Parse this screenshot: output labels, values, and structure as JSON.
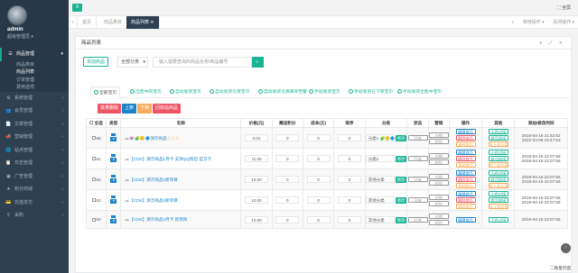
{
  "sidebar": {
    "username": "admin",
    "role": "超级管理员 ▾",
    "menu": [
      {
        "label": "商品管理",
        "active": true
      },
      {
        "label": "商品类目"
      },
      {
        "label": "商品列表",
        "current": true
      },
      {
        "label": "订单管理"
      },
      {
        "label": "费用选项"
      },
      {
        "label": "系统管理"
      },
      {
        "label": "会员管理"
      },
      {
        "label": "文章管理"
      },
      {
        "label": "营销管理"
      },
      {
        "label": "站点管理"
      },
      {
        "label": "日志管理"
      },
      {
        "label": "广告管理"
      },
      {
        "label": "积分商城"
      },
      {
        "label": "充值支付"
      },
      {
        "label": "采购"
      }
    ]
  },
  "topbar": {
    "fullscreen": "全屏"
  },
  "tabs": {
    "items": [
      "首页",
      "商品类目",
      "商品列表"
    ],
    "tools": [
      "常用操作 ▾",
      "关闭操作 ▾"
    ]
  },
  "panel": {
    "title": "商品列表",
    "controls": "▾ ⤢ ✕",
    "add_button": "添加商品",
    "category_select": "全部分类",
    "search_placeholder": "输入需要查询的商品名称/商品编号",
    "search_button": "搜索"
  },
  "filter_tabs": [
    "全部宝贝",
    "出售中的宝贝",
    "自动发货宝贝",
    "自动发货仓库宝贝",
    "自动发货仓库库存告警",
    "手动发货宝贝",
    "手动发货已下架宝贝",
    "手动发货出售中宝贝"
  ],
  "actions": [
    {
      "label": "批量删除",
      "color": "#ed5565"
    },
    {
      "label": "上架",
      "color": "#1c84c6"
    },
    {
      "label": "下架",
      "color": "#f8ac59"
    },
    {
      "label": "回收站商品",
      "color": "#ed5565"
    }
  ],
  "table": {
    "headers": [
      "全选",
      "类型",
      "名称",
      "价格(元)",
      "赠送积分",
      "成本(元)",
      "排序",
      "分类",
      "状态",
      "营销",
      "操作",
      "其他",
      "添加/修改时间"
    ],
    "rows": [
      {
        "id": "58",
        "name": "演示商品",
        "prefix": "👾🧩🙂🔷",
        "stars": "☆☆☆",
        "price": "0.01",
        "points": "0",
        "cost": "0",
        "sort": "0",
        "category": "分类1 🧩🙂🔷",
        "status": "开放",
        "tags": [
          "分销",
          "短信"
        ],
        "ops": [
          "编辑商品",
          "删除商品",
          "复制商品"
        ],
        "others": [
          "小鸡对接",
          "商品链接",
          "发上架价值"
        ],
        "time1": "2019-04-16 21:52:52",
        "time2": "2022-04-08 15:47:53"
      },
      {
        "id": "61",
        "name": "【CDK】演示商品1月卡 支持QQ钱包 官方卡",
        "prefix": "",
        "stars": "",
        "price": "11.00",
        "points": "0",
        "cost": "0",
        "sort": "0",
        "category": "分类2",
        "status": "开放",
        "tags": [
          "分销",
          "短信"
        ],
        "ops": [
          "编辑商品",
          "删除商品",
          "复制商品"
        ],
        "others": [
          "小鸡对接",
          "商品链接",
          "发上架价值"
        ],
        "time1": "2019-04-16 22:07:56",
        "time2": "2019-04-16 22:07:56"
      },
      {
        "id": "62",
        "name": "【CDK】演示商品2新项目",
        "prefix": "",
        "stars": "",
        "price": "10.00",
        "points": "0",
        "cost": "0",
        "sort": "0",
        "category": "其他分类",
        "status": "开放",
        "tags": [
          "分销",
          "短信"
        ],
        "ops": [
          "编辑商品",
          "删除商品",
          "复制商品"
        ],
        "others": [
          "小鸡对接",
          "商品链接",
          "发上架价值"
        ],
        "time1": "2019-04-16 22:07:56",
        "time2": "2019-04-16 22:07:56"
      },
      {
        "id": "63",
        "name": "【CDK】演示商品3新项目",
        "prefix": "",
        "stars": "",
        "price": "10.00",
        "points": "0",
        "cost": "0",
        "sort": "0",
        "category": "其他分类",
        "status": "开放",
        "tags": [
          "分销",
          "短信"
        ],
        "ops": [
          "编辑商品",
          "删除商品",
          "复制商品"
        ],
        "others": [
          "小鸡对接",
          "商品链接",
          "发上架价值"
        ],
        "time1": "2019-04-16 22:07:56",
        "time2": "2019-04-16 22:07:56"
      },
      {
        "id": "64",
        "name": "【CDK】演示商品4月卡 新项目",
        "prefix": "",
        "stars": "",
        "price": "10.00",
        "points": "0",
        "cost": "0",
        "sort": "0",
        "category": "其他分类",
        "status": "开放",
        "tags": [
          "分销",
          "短信"
        ],
        "ops": [
          "编辑商品"
        ],
        "others": [
          "小鸡对接"
        ],
        "time1": "2019-04-16 22:07:56",
        "time2": ""
      }
    ]
  },
  "footer": "二数量页面"
}
